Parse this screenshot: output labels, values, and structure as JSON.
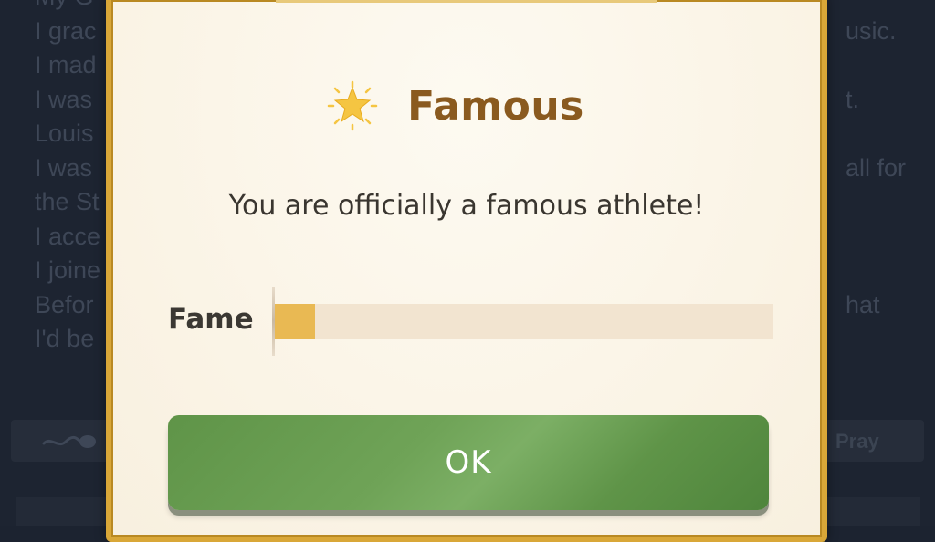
{
  "background": {
    "lines": [
      {
        "text": "My G",
        "right": ""
      },
      {
        "text": "I grac",
        "right": "usic."
      },
      {
        "text": "I mad",
        "right": ""
      },
      {
        "text": "I was",
        "right": "t."
      },
      {
        "text": "Louis",
        "right": ""
      },
      {
        "text": "I was",
        "right": "all for"
      },
      {
        "text": "the St",
        "right": ""
      },
      {
        "text": "I acce",
        "right": ""
      },
      {
        "text": "I joine",
        "right": ""
      },
      {
        "text": "Befor",
        "right": "hat"
      },
      {
        "text": "I'd be",
        "right": ""
      }
    ],
    "pray_label": "Pray",
    "bar_icon": "sperm-icon"
  },
  "modal": {
    "title": "Famous",
    "title_icon": "star-icon",
    "message": "You are officially a famous athlete!",
    "fame_label": "Fame",
    "fame_progress": 0.08,
    "ok_label": "OK"
  },
  "colors": {
    "modal_border": "#d9a738",
    "title": "#8a5a1f",
    "fame_fill": "#e9b953",
    "fame_track": "#f2e4d0",
    "ok_button": "#6fa357",
    "star": "#f5c542"
  }
}
